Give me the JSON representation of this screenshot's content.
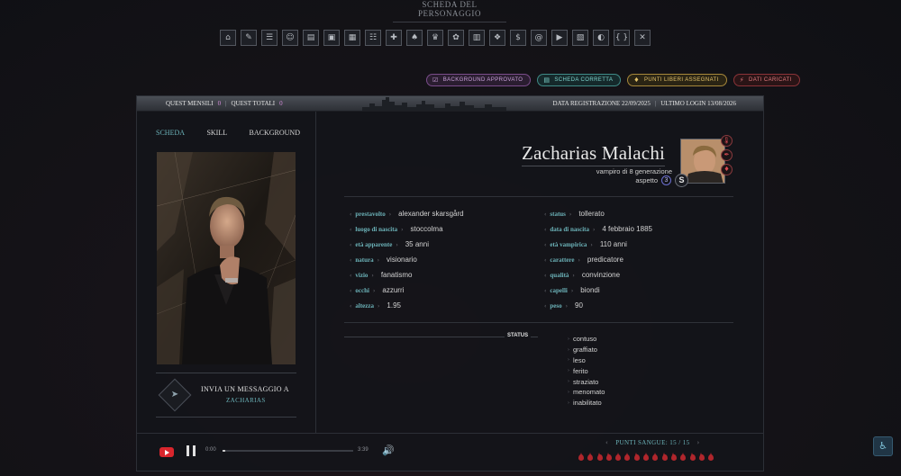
{
  "page": {
    "title": "SCHEDA DEL PERSONAGGIO"
  },
  "toolbar": {
    "icons": [
      "⌂",
      "✎",
      "☰",
      "☺",
      "▤",
      "▣",
      "▦",
      "☷",
      "✚",
      "♠",
      "♛",
      "✿",
      "▥",
      "❖",
      "$",
      "@",
      "▶",
      "▧",
      "◐",
      "{ }",
      "✕"
    ]
  },
  "badges": [
    {
      "label": "background approvato",
      "icon": "☑",
      "tone": "purple"
    },
    {
      "label": "scheda corretta",
      "icon": "▤",
      "tone": "teal"
    },
    {
      "label": "punti liberi assegnati",
      "icon": "♦",
      "tone": "gold"
    },
    {
      "label": "dati caricati",
      "icon": "⚡",
      "tone": "red"
    }
  ],
  "header": {
    "quest_mensili_label": "QUEST MENSILI",
    "quest_mensili_value": "0",
    "quest_totali_label": "QUEST TOTALI",
    "quest_totali_value": "0",
    "registration": "DATA REGISTRAZIONE 22/09/2025",
    "last_login": "ULTIMO LOGIN 13/08/2026",
    "sep": "|"
  },
  "tabs": [
    {
      "label": "SCHEDA",
      "active": true
    },
    {
      "label": "SKILL",
      "active": false
    },
    {
      "label": "BACKGROUND",
      "active": false
    }
  ],
  "message": {
    "line1": "INVIA UN MESSAGGIO A",
    "line2": "ZACHARIAS"
  },
  "character": {
    "name": "Zacharias Malachi",
    "subtitle": "vampiro di 8 generazione",
    "aspect_label": "aspetto",
    "aspect_value": "3",
    "s_badge": "S"
  },
  "attributes_left": [
    {
      "label": "prestavolto",
      "value": "alexander skarsgård"
    },
    {
      "label": "luogo di nascita",
      "value": "stoccolma"
    },
    {
      "label": "età apparente",
      "value": "35 anni"
    },
    {
      "label": "natura",
      "value": "visionario"
    },
    {
      "label": "vizio",
      "value": "fanatismo"
    },
    {
      "label": "occhi",
      "value": "azzurri"
    },
    {
      "label": "altezza",
      "value": "1.95"
    }
  ],
  "attributes_right": [
    {
      "label": "status",
      "value": "tollerato"
    },
    {
      "label": "data di nascita",
      "value": "4 febbraio 1885"
    },
    {
      "label": "età vampirica",
      "value": "110 anni"
    },
    {
      "label": "carattere",
      "value": "predicatore"
    },
    {
      "label": "qualità",
      "value": "convinzione"
    },
    {
      "label": "capelli",
      "value": "biondi"
    },
    {
      "label": "peso",
      "value": "90"
    }
  ],
  "status": {
    "title": "STATUS",
    "items": [
      "contuso",
      "graffiato",
      "leso",
      "ferito",
      "straziato",
      "menomato",
      "inabilitato"
    ]
  },
  "player": {
    "time_start": "0:00",
    "time_end": "3:39",
    "progress": 0.02
  },
  "blood": {
    "label": "PUNTI SANGUE: 15 / 15",
    "current": 15,
    "max": 15
  },
  "colors": {
    "accent": "#6cb3b9",
    "blood": "#b0262c",
    "background": "#14151a"
  }
}
